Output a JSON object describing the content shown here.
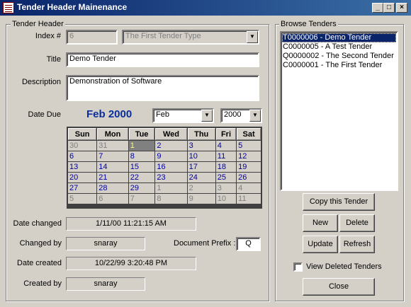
{
  "window": {
    "title": "Tender Header Mainenance",
    "buttons": {
      "min": "_",
      "max": "□",
      "close": "×"
    }
  },
  "header_group": {
    "label": "Tender Header",
    "index_label": "Index #",
    "index_value": "6",
    "type_value": "The First Tender Type",
    "title_label": "Title",
    "title_value": "Demo Tender",
    "description_label": "Description",
    "description_value": "Demonstration of Software",
    "date_due_label": "Date Due",
    "calendar": {
      "caption": "Feb 2000",
      "month_value": "Feb",
      "year_value": "2000",
      "days": [
        "Sun",
        "Mon",
        "Tue",
        "Wed",
        "Thu",
        "Fri",
        "Sat"
      ],
      "weeks": [
        [
          {
            "d": "30",
            "o": true
          },
          {
            "d": "31",
            "o": true
          },
          {
            "d": "1",
            "s": true
          },
          {
            "d": "2"
          },
          {
            "d": "3"
          },
          {
            "d": "4"
          },
          {
            "d": "5"
          }
        ],
        [
          {
            "d": "6"
          },
          {
            "d": "7"
          },
          {
            "d": "8"
          },
          {
            "d": "9"
          },
          {
            "d": "10"
          },
          {
            "d": "11"
          },
          {
            "d": "12"
          }
        ],
        [
          {
            "d": "13"
          },
          {
            "d": "14"
          },
          {
            "d": "15"
          },
          {
            "d": "16"
          },
          {
            "d": "17"
          },
          {
            "d": "18"
          },
          {
            "d": "19"
          }
        ],
        [
          {
            "d": "20"
          },
          {
            "d": "21"
          },
          {
            "d": "22"
          },
          {
            "d": "23"
          },
          {
            "d": "24"
          },
          {
            "d": "25"
          },
          {
            "d": "26"
          }
        ],
        [
          {
            "d": "27"
          },
          {
            "d": "28"
          },
          {
            "d": "29"
          },
          {
            "d": "1",
            "o": true
          },
          {
            "d": "2",
            "o": true
          },
          {
            "d": "3",
            "o": true
          },
          {
            "d": "4",
            "o": true
          }
        ],
        [
          {
            "d": "5",
            "o": true
          },
          {
            "d": "6",
            "o": true
          },
          {
            "d": "7",
            "o": true
          },
          {
            "d": "8",
            "o": true
          },
          {
            "d": "9",
            "o": true
          },
          {
            "d": "10",
            "o": true
          },
          {
            "d": "11",
            "o": true
          }
        ]
      ]
    },
    "date_changed_label": "Date changed",
    "date_changed_value": "1/11/00 11:21:15 AM",
    "changed_by_label": "Changed by",
    "changed_by_value": "snaray",
    "document_prefix_label": "Document Prefix :",
    "document_prefix_value": "Q",
    "date_created_label": "Date created",
    "date_created_value": "10/22/99 3:20:48 PM",
    "created_by_label": "Created by",
    "created_by_value": "snaray"
  },
  "browse_group": {
    "label": "Browse Tenders",
    "items": [
      {
        "text": "T0000006 - Demo Tender",
        "selected": true
      },
      {
        "text": "C0000005 - A Test Tender"
      },
      {
        "text": "Q0000002 - The Second Tender"
      },
      {
        "text": "C0000001 - The First Tender"
      }
    ],
    "copy_label": "Copy this Tender",
    "new_label": "New",
    "delete_label": "Delete",
    "update_label": "Update",
    "refresh_label": "Refresh",
    "view_deleted_label": "View Deleted Tenders",
    "view_deleted_checked": false,
    "close_label": "Close"
  },
  "colors": {
    "titlebar": "#0a246a",
    "calendar_caption": "#0a2d9c",
    "calendar_day": "#0000a0",
    "selection": "#0a246a"
  }
}
